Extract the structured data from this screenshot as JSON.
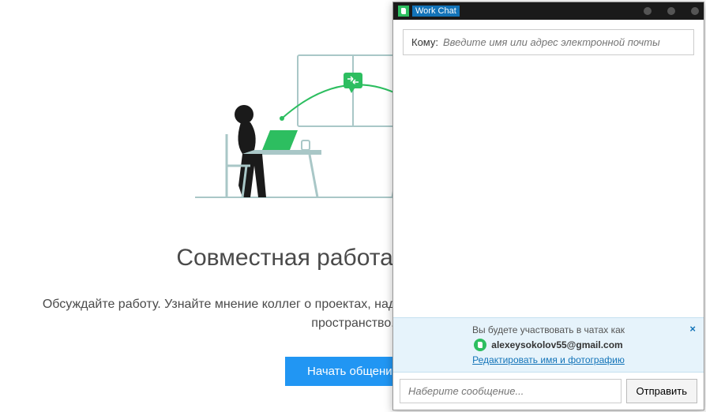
{
  "landing": {
    "title": "Совместная работа с Work Chat",
    "subtitle": "Обсуждайте работу. Узнайте мнение коллег о проектах, над которыми вы работаете, не покидая рабочее пространство.",
    "start_button": "Начать общение"
  },
  "chat": {
    "window_title": "Work Chat",
    "to_label": "Кому:",
    "to_placeholder": "Введите имя или адрес электронной почты",
    "identity_line1": "Вы будете участвовать в чатах как",
    "identity_email": "alexeysokolov55@gmail.com",
    "identity_link": "Редактировать имя и фотографию",
    "compose_placeholder": "Наберите сообщение...",
    "send_button": "Отправить"
  }
}
